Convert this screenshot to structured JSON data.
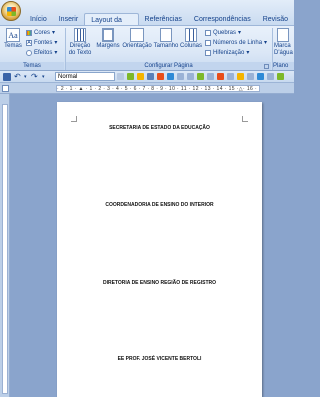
{
  "tabs": [
    "Início",
    "Inserir",
    "Layout da Página",
    "Referências",
    "Correspondências",
    "Revisão"
  ],
  "active_tab": "Layout da Página",
  "ribbon": {
    "temas_group": {
      "temas_label": "Temas",
      "cores_label": "Cores",
      "fontes_label": "Fontes",
      "efeitos_label": "Efeitos",
      "group_label": "Temas"
    },
    "page_setup_group": {
      "direcao_label": "Direção do Texto",
      "margens_label": "Margens",
      "orientacao_label": "Orientação",
      "tamanho_label": "Tamanho",
      "colunas_label": "Colunas",
      "quebras_label": "Quebras",
      "numeros_linha_label": "Números de Linha",
      "hifenizacao_label": "Hifenização",
      "group_label": "Configurar Página"
    },
    "fundo_group": {
      "marca_label": "Marca D'água",
      "group_label": "Plano"
    }
  },
  "style_box": {
    "value": "Normal"
  },
  "ruler": {
    "text": "· 2 · 1 · ▲ · 1 · 2 · 3 · 4 · 5 · 6 · 7 · 8 · 9 · 10 · 11 · 12 · 13 · 14 · 15 ·△· 16 ·"
  },
  "document": {
    "line1": "SECRETARIA DE ESTADO DA EDUCAÇÃO",
    "line2": "COORDENADORIA DE ENSINO DO INTERIOR",
    "line3": "DIRETORIA DE ENSINO REGIÃO DE REGISTRO",
    "line4": "EE PROF. JOSÉ VICENTE BERTOLI"
  },
  "colors": {
    "ribbon_bg": "#dbe7f6",
    "accent": "#15428b",
    "workspace": "#8aa4cc"
  }
}
